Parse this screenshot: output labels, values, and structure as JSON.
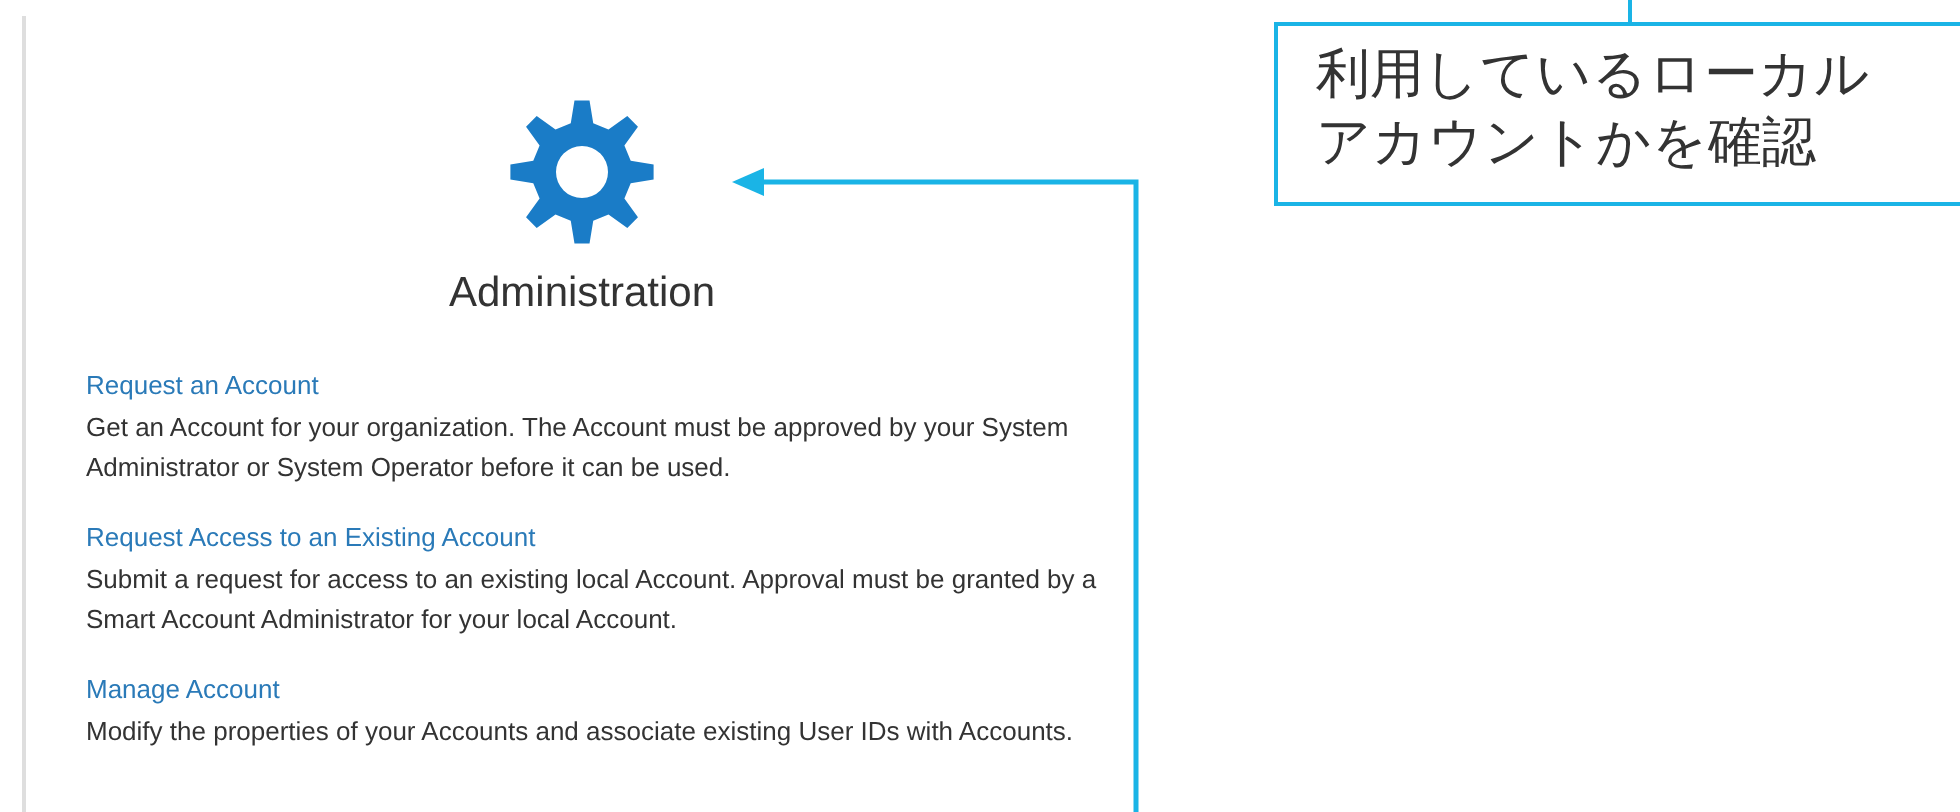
{
  "panel": {
    "title": "Administration",
    "sections": [
      {
        "link": "Request an Account",
        "description": "Get an Account for your organization. The Account must be approved by your System Administrator or System Operator before it can be used."
      },
      {
        "link": "Request Access to an Existing Account",
        "description": "Submit a request for access to an existing local Account. Approval must be granted by a Smart Account Administrator for your local Account."
      },
      {
        "link": "Manage Account",
        "description": "Modify the properties of your Accounts and associate existing User IDs with Accounts."
      }
    ]
  },
  "callout": {
    "lines": [
      "利用しているローカル",
      "アカウントかを確認"
    ]
  }
}
